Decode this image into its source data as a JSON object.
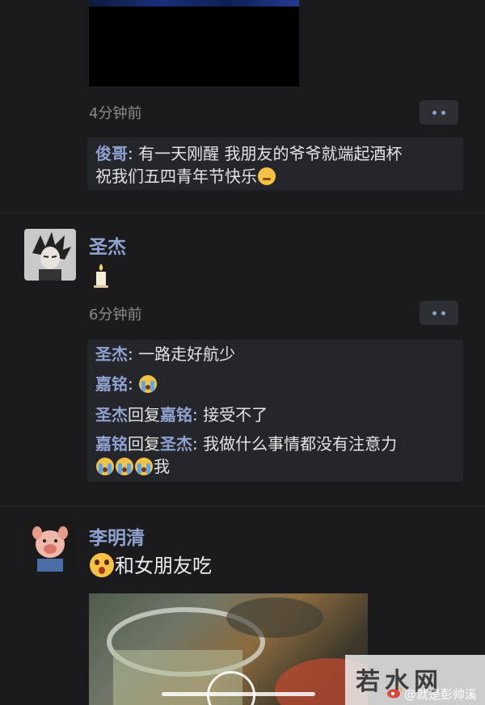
{
  "post1": {
    "time": "4分钟前",
    "comment": {
      "name": "俊哥",
      "sep": ": ",
      "text_line1": "有一天刚醒 我朋友的爷爷就端起酒杯",
      "text_line2": "祝我们五四青年节快乐",
      "emoji": "flushed-face"
    }
  },
  "post2": {
    "username": "圣杰",
    "content_emoji": "candle",
    "time": "6分钟前",
    "comments": [
      {
        "name": "圣杰",
        "sep": ": ",
        "text": "一路走好航少"
      },
      {
        "name": "嘉铭",
        "sep": ": ",
        "emoji": "loudly-crying-face"
      },
      {
        "name": "圣杰",
        "reply_word": "回复",
        "reply_to": "嘉铭",
        "sep": ": ",
        "text": "接受不了"
      },
      {
        "name": "嘉铭",
        "reply_word": "回复",
        "reply_to": "圣杰",
        "sep": ": ",
        "text": "我做什么事情都没有注意力",
        "trailing_text": "我",
        "trailing_emojis": [
          "loudly-crying-face",
          "loudly-crying-face",
          "loudly-crying-face"
        ]
      }
    ]
  },
  "post3": {
    "username": "李明清",
    "content_emoji": "astonished-face",
    "content_text": "和女朋友吃"
  },
  "watermark": {
    "site": "若水网",
    "weibo": "就是彭帅溪"
  },
  "colors": {
    "background": "#1b1b1d",
    "nickname": "#8fa3d0",
    "comment_box": "#25262b",
    "time": "#8a8a8e"
  }
}
